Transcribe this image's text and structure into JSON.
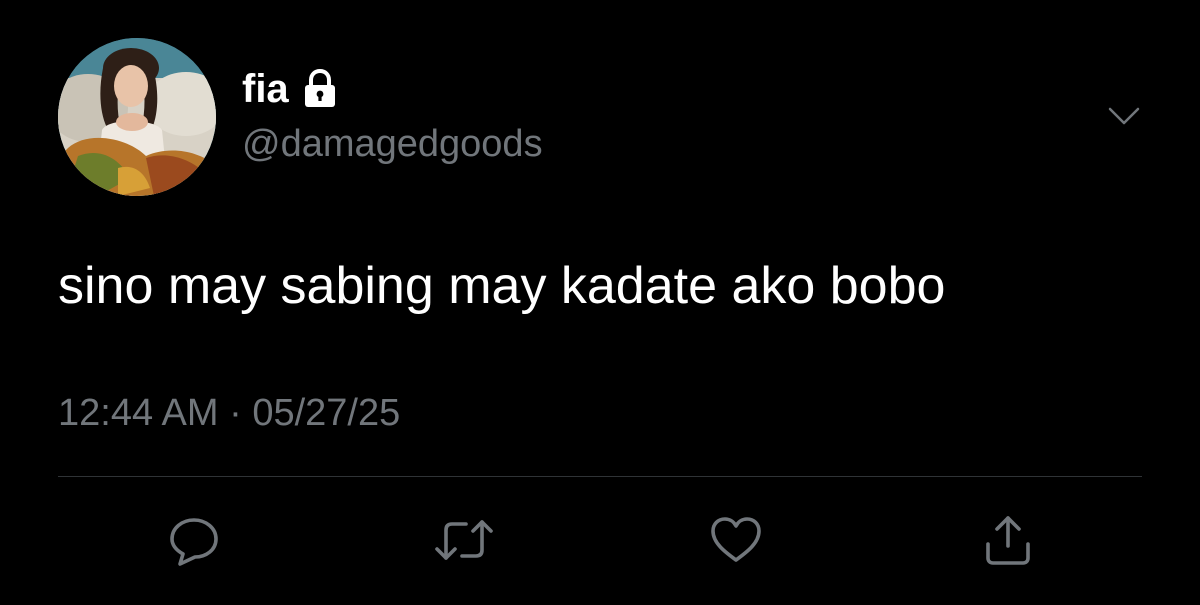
{
  "user": {
    "display_name": "fia",
    "handle": "@damagedgoods"
  },
  "tweet": {
    "text": "sino may sabing may kadate ako bobo",
    "time": "12:44 AM",
    "separator": "·",
    "date": "05/27/25"
  },
  "icons": {
    "lock": "lock-icon",
    "more": "chevron-down-icon",
    "reply": "reply-icon",
    "retweet": "retweet-icon",
    "like": "heart-icon",
    "share": "share-icon"
  },
  "colors": {
    "background": "#000000",
    "primary_text": "#ffffff",
    "secondary_text": "#71767b",
    "divider": "#2f3336"
  }
}
